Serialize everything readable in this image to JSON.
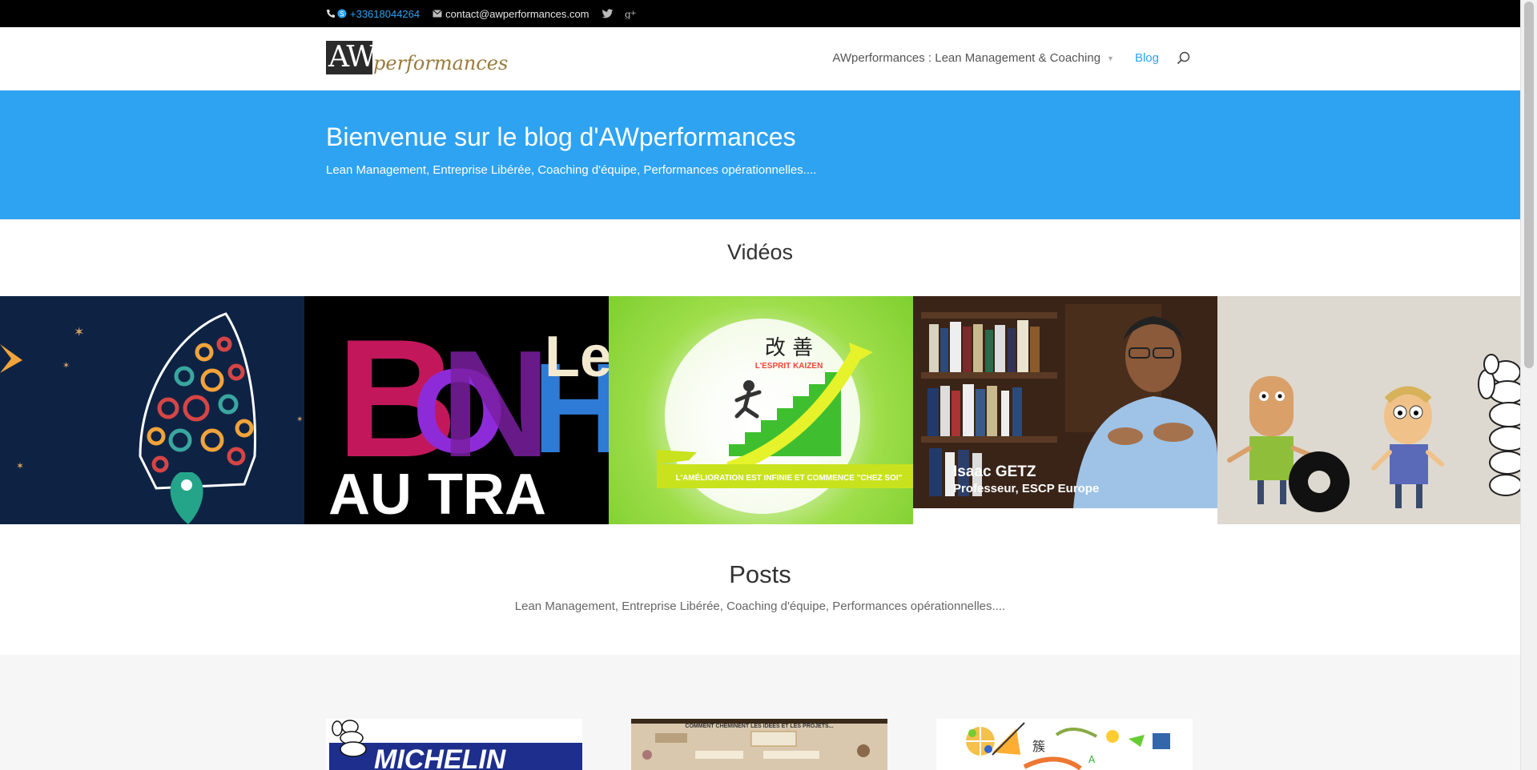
{
  "topbar": {
    "phone": "+33618044264",
    "email": "contact@awperformances.com",
    "icons": [
      "phone-icon",
      "skype-icon",
      "envelope-icon",
      "twitter-icon",
      "google-plus-icon"
    ]
  },
  "header": {
    "logo_mark": "AW",
    "logo_text": "performances",
    "nav": [
      {
        "label": "AWperformances : Lean Management & Coaching",
        "has_submenu": true
      },
      {
        "label": "Blog",
        "active": true
      }
    ],
    "search_icon": "search-icon"
  },
  "hero": {
    "title": "Bienvenue sur le blog d'AWperformances",
    "subtitle": "Lean Management, Entreprise Libérée, Coaching d'équipe, Performances opérationnelles...."
  },
  "videos": {
    "title": "Vidéos",
    "tiles": [
      {
        "caption": ""
      },
      {
        "caption_line1": "Le",
        "caption_line2": "BONH",
        "caption_line3": "AU TRA"
      },
      {
        "chinese": "改 善",
        "brand": "L'ESPRIT KAIZEN",
        "banner": "L'AMÉLIORATION EST INFINIE ET COMMENCE \"CHEZ SOI\""
      },
      {
        "name": "Isaac GETZ",
        "role": "Professeur, ESCP Europe"
      },
      {
        "caption": ""
      }
    ]
  },
  "posts": {
    "title": "Posts",
    "subtitle": "Lean Management, Entreprise Libérée, Coaching d'équipe, Performances opérationnelles....",
    "thumbs": [
      {
        "text": "MICHELIN"
      },
      {
        "text": "COMMENT CHEMINENT LES IDÉES ET LES PROJETS..."
      },
      {
        "text": ""
      }
    ]
  },
  "colors": {
    "accent": "#2ea3f2",
    "topbar": "#000000",
    "logo_gold": "#9a7b3e"
  }
}
